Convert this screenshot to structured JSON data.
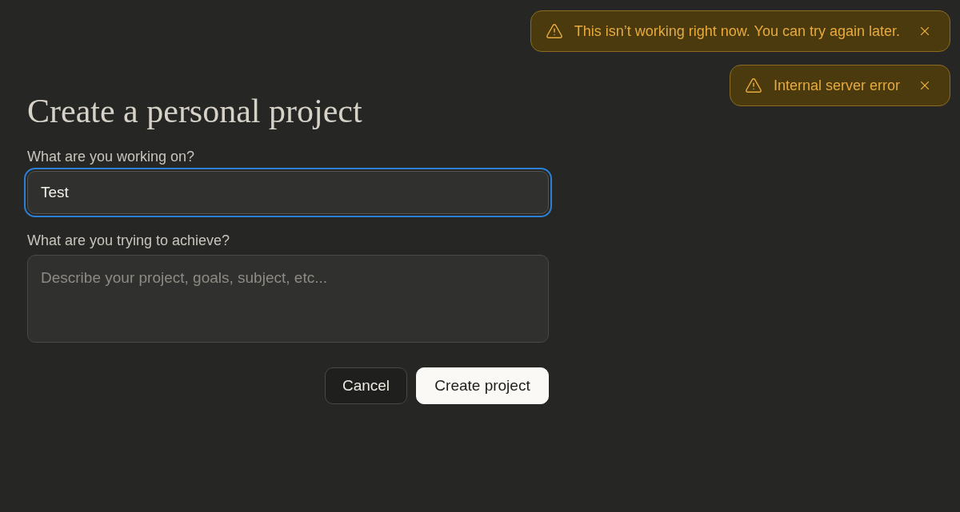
{
  "toasts": [
    {
      "kind": "warning",
      "message": "This isn’t working right now. You can try again later."
    },
    {
      "kind": "warning",
      "message": "Internal server error"
    }
  ],
  "form": {
    "title": "Create a personal project",
    "fields": [
      {
        "kind": "input",
        "label": "What are you working on?",
        "value": "Test",
        "focused": true
      },
      {
        "kind": "textarea",
        "label": "What are you trying to achieve?",
        "placeholder": "Describe your project, goals, subject, etc...",
        "focused": false
      }
    ],
    "buttons": [
      {
        "kind": "secondary",
        "label": "Cancel"
      },
      {
        "kind": "primary",
        "label": "Create project"
      }
    ]
  }
}
